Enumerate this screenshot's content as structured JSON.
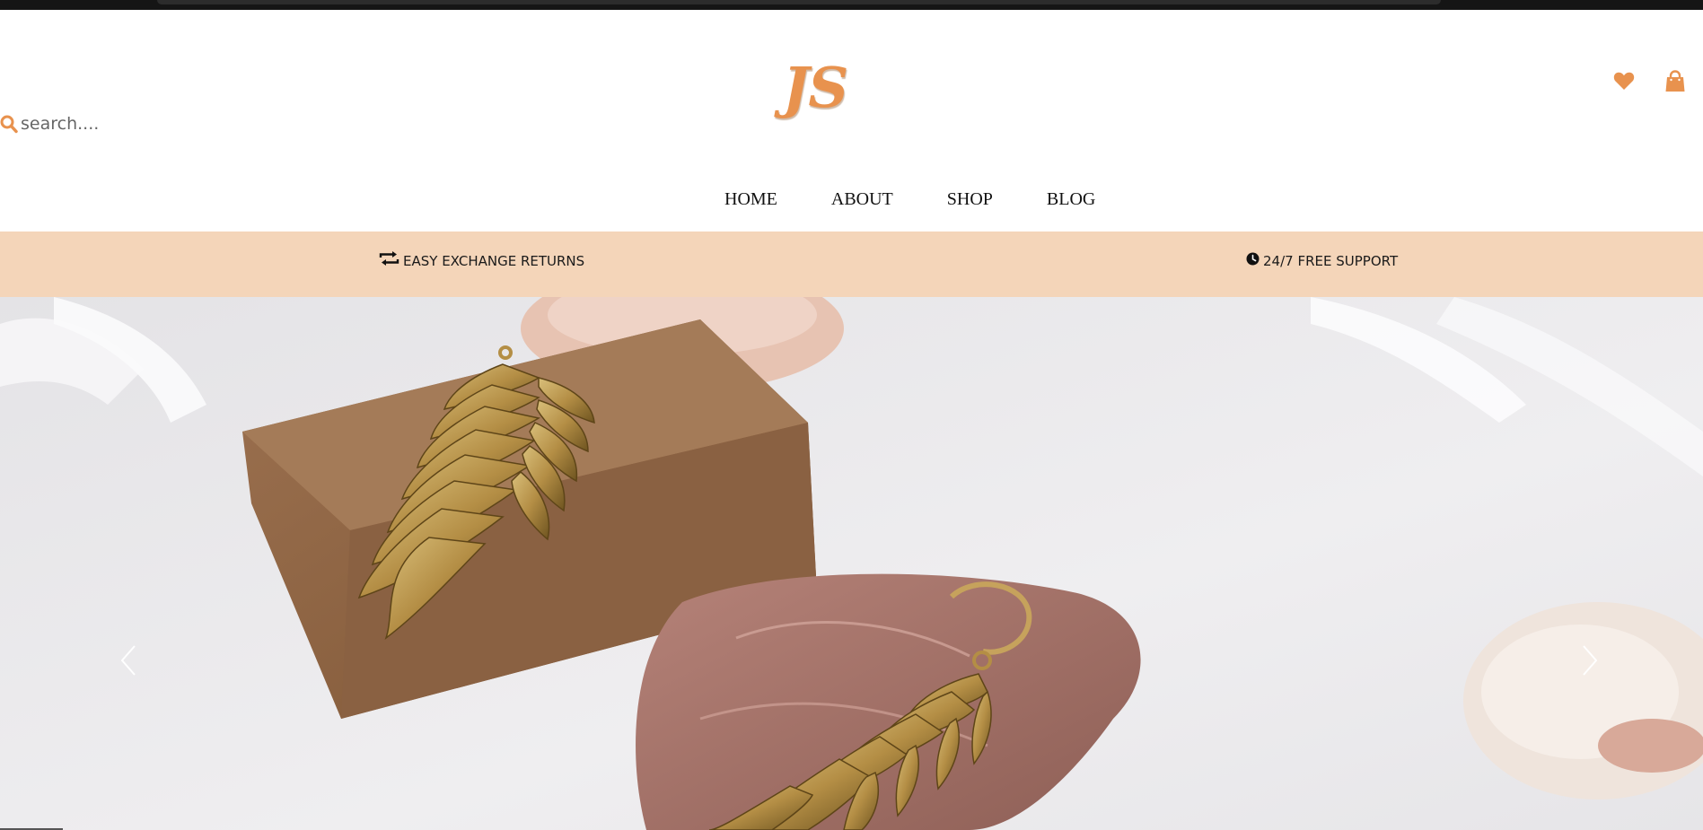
{
  "header": {
    "logo": "JS",
    "search": {
      "placeholder": "search....",
      "icon": "search-icon"
    },
    "icons": {
      "wishlist": "heart-icon",
      "cart": "shopping-bag-icon"
    }
  },
  "nav": {
    "items": [
      {
        "label": "HOME"
      },
      {
        "label": "ABOUT"
      },
      {
        "label": "SHOP"
      },
      {
        "label": "BLOG"
      }
    ]
  },
  "promo": {
    "items": [
      {
        "icon": "exchange-icon",
        "label": "EASY EXCHANGE RETURNS"
      },
      {
        "icon": "clock-icon",
        "label": "24/7 FREE SUPPORT"
      }
    ]
  },
  "hero": {
    "prev_icon": "chevron-left-icon",
    "next_icon": "chevron-right-icon"
  },
  "colors": {
    "accent": "#e8924e",
    "promo_background": "#f4d5b9",
    "text": "#111111"
  }
}
